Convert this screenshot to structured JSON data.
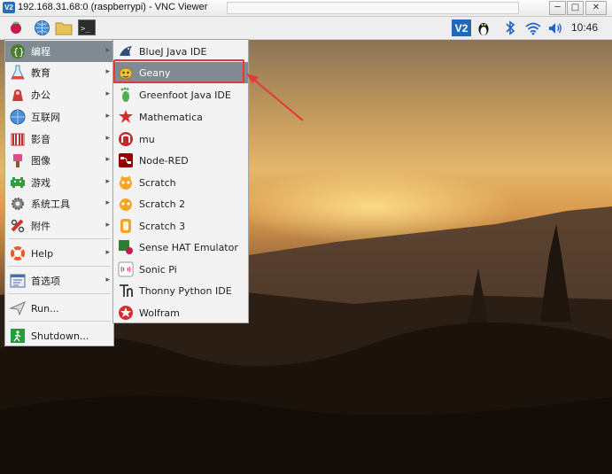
{
  "window": {
    "logo": "V2",
    "title": "192.168.31.68:0 (raspberrypi) - VNC Viewer",
    "min_label": "─",
    "max_label": "□",
    "close_label": "✕"
  },
  "panel": {
    "clock": "10:46",
    "launchers": [
      "raspberry-icon",
      "globe-icon",
      "folder-icon",
      "terminal-icon"
    ],
    "tray": [
      "vnc-icon",
      "tux-icon",
      "bluetooth-icon",
      "wifi-icon",
      "volume-icon"
    ],
    "vnc_label": "V2",
    "terminal_label": ">_"
  },
  "main_menu": {
    "items": [
      {
        "label": "编程",
        "icon": "programming-icon",
        "has_submenu": true,
        "selected": true
      },
      {
        "label": "教育",
        "icon": "education-icon",
        "has_submenu": true
      },
      {
        "label": "办公",
        "icon": "office-icon",
        "has_submenu": true
      },
      {
        "label": "互联网",
        "icon": "internet-icon",
        "has_submenu": true
      },
      {
        "label": "影音",
        "icon": "media-icon",
        "has_submenu": true
      },
      {
        "label": "图像",
        "icon": "graphics-icon",
        "has_submenu": true
      },
      {
        "label": "游戏",
        "icon": "games-icon",
        "has_submenu": true
      },
      {
        "label": "系统工具",
        "icon": "system-tools-icon",
        "has_submenu": true
      },
      {
        "label": "附件",
        "icon": "accessories-icon",
        "has_submenu": true
      },
      {
        "label": "Help",
        "icon": "help-icon",
        "has_submenu": true
      },
      {
        "label": "首选项",
        "icon": "preferences-icon",
        "has_submenu": true
      },
      {
        "label": "Run...",
        "icon": "run-icon",
        "has_submenu": false
      },
      {
        "label": "Shutdown...",
        "icon": "shutdown-icon",
        "has_submenu": false
      }
    ],
    "arrow": "▸"
  },
  "programming_submenu": {
    "items": [
      {
        "label": "BlueJ Java IDE",
        "icon": "bluej-icon"
      },
      {
        "label": "Geany",
        "icon": "geany-icon",
        "highlighted": true
      },
      {
        "label": "Greenfoot Java IDE",
        "icon": "greenfoot-icon"
      },
      {
        "label": "Mathematica",
        "icon": "mathematica-icon"
      },
      {
        "label": "mu",
        "icon": "mu-icon"
      },
      {
        "label": "Node-RED",
        "icon": "node-red-icon"
      },
      {
        "label": "Scratch",
        "icon": "scratch-icon"
      },
      {
        "label": "Scratch 2",
        "icon": "scratch2-icon"
      },
      {
        "label": "Scratch 3",
        "icon": "scratch3-icon"
      },
      {
        "label": "Sense HAT Emulator",
        "icon": "sense-hat-icon"
      },
      {
        "label": "Sonic Pi",
        "icon": "sonic-pi-icon"
      },
      {
        "label": "Thonny Python IDE",
        "icon": "thonny-icon"
      },
      {
        "label": "Wolfram",
        "icon": "wolfram-icon"
      }
    ]
  },
  "annotation": {
    "color": "#e53935"
  }
}
